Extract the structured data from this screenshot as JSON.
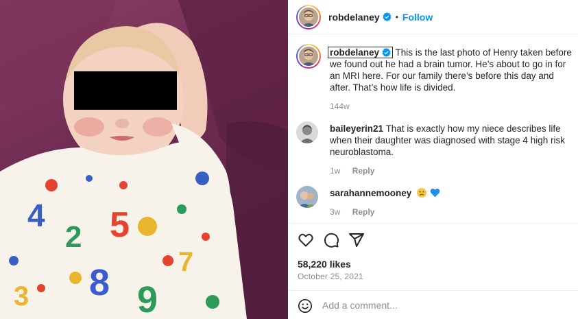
{
  "post": {
    "author": "robdelaney",
    "follow_label": "Follow",
    "separator": "•",
    "likes": "58,220 likes",
    "date": "October 25, 2021"
  },
  "caption": {
    "user": "robdelaney",
    "text": "This is the last photo of Henry taken before we found out he had a brain tumor. He’s about to go in for an MRI here. For our family there’s before this day and after. That’s how life is divided.",
    "time": "144w"
  },
  "comments": [
    {
      "user": "baileyerin21",
      "text": "That is exactly how my niece describes life when their daughter was diagnosed with stage 4 high risk neuroblastoma.",
      "time": "1w",
      "reply_label": "Reply"
    },
    {
      "user": "sarahannemooney",
      "text": "",
      "time": "3w",
      "reply_label": "Reply"
    }
  ],
  "add_comment": {
    "placeholder": "Add a comment..."
  },
  "colors": {
    "link": "#0095f6",
    "muted": "#8e8e8e",
    "text": "#262626",
    "photo_bg": "#6d2a50"
  },
  "icons": [
    "verified-badge-icon",
    "heart-icon",
    "comment-icon",
    "share-icon",
    "emoji-icon"
  ]
}
